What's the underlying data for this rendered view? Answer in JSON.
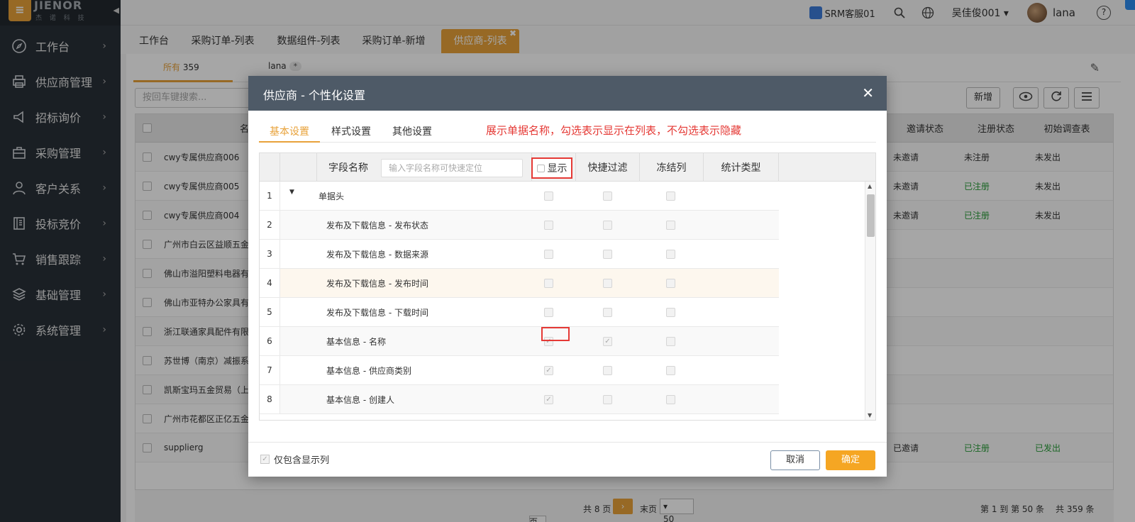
{
  "logo": {
    "text": "JIENOR",
    "sub": "杰 诺 科 技"
  },
  "sidebar": {
    "items": [
      {
        "label": "工作台",
        "icon": "compass-icon"
      },
      {
        "label": "供应商管理",
        "icon": "printer-icon"
      },
      {
        "label": "招标询价",
        "icon": "megaphone-icon"
      },
      {
        "label": "采购管理",
        "icon": "briefcase-icon"
      },
      {
        "label": "客户关系",
        "icon": "user-icon"
      },
      {
        "label": "投标竞价",
        "icon": "book-icon"
      },
      {
        "label": "销售跟踪",
        "icon": "cart-icon"
      },
      {
        "label": "基础管理",
        "icon": "layers-icon"
      },
      {
        "label": "系统管理",
        "icon": "gear-icon"
      }
    ]
  },
  "topbar": {
    "srm": "SRM客服01",
    "user_drop": "吴佳俊001",
    "username": "lana"
  },
  "page_tabs": [
    "工作台",
    "采购订单-列表",
    "数据组件-列表",
    "采购订单-新增",
    "供应商-列表"
  ],
  "sub_tabs": {
    "all_label": "所有",
    "all_count": "359",
    "lana_label": "lana",
    "lana_badge": "*"
  },
  "search": {
    "placeholder": "按回车键搜索..."
  },
  "toolbar": {
    "new_label": "新增"
  },
  "grid": {
    "headers": {
      "name": "名称",
      "invite": "邀请状态",
      "register": "注册状态",
      "survey": "初始调查表"
    },
    "rows": [
      {
        "name": "cwy专属供应商006",
        "invite": "未邀请",
        "register": "未注册",
        "survey": "未发出",
        "reg_green": false
      },
      {
        "name": "cwy专属供应商005",
        "invite": "未邀请",
        "register": "已注册",
        "survey": "未发出",
        "reg_green": true
      },
      {
        "name": "cwy专属供应商004",
        "invite": "未邀请",
        "register": "已注册",
        "survey": "未发出",
        "reg_green": true
      },
      {
        "name": "广州市白云区益顺五金",
        "invite": "",
        "register": "",
        "survey": "",
        "reg_green": false
      },
      {
        "name": "佛山市溢阳塑料电器有",
        "invite": "",
        "register": "",
        "survey": "",
        "reg_green": false
      },
      {
        "name": "佛山市亚特办公家具有",
        "invite": "",
        "register": "",
        "survey": "",
        "reg_green": false
      },
      {
        "name": "浙江联通家具配件有限",
        "invite": "",
        "register": "",
        "survey": "",
        "reg_green": false
      },
      {
        "name": "苏世博（南京）减振系",
        "invite": "",
        "register": "",
        "survey": "",
        "reg_green": false
      },
      {
        "name": "凯斯宝玛五金贸易（上",
        "invite": "",
        "register": "",
        "survey": "",
        "reg_green": false
      },
      {
        "name": "广州市花都区正亿五金",
        "invite": "",
        "register": "",
        "survey": "",
        "reg_green": false
      },
      {
        "name": "supplierg",
        "invite": "已邀请",
        "register": "已注册",
        "survey": "已发出",
        "reg_green": true
      }
    ]
  },
  "pager": {
    "page_prefix": "第",
    "page_suffix": "页",
    "total_pages": "共 8 页",
    "last": "末页",
    "page_size": "50",
    "range": "第 1 到 第 50 条",
    "total": "共 359 条"
  },
  "modal": {
    "title": "供应商 - 个性化设置",
    "tabs": [
      "基本设置",
      "样式设置",
      "其他设置"
    ],
    "hint": "展示单据名称，勾选表示显示在列表，不勾选表示隐藏",
    "headers": {
      "field_name": "字段名称",
      "search_placeholder": "输入字段名称可快速定位",
      "show": "显示",
      "quick_filter": "快捷过滤",
      "freeze": "冻结列",
      "stat_type": "统计类型"
    },
    "rows": [
      {
        "num": "1",
        "name": "单据头",
        "show": false,
        "filter": false,
        "freeze": false
      },
      {
        "num": "2",
        "name": "发布及下载信息 - 发布状态",
        "show": false,
        "filter": false,
        "freeze": false
      },
      {
        "num": "3",
        "name": "发布及下载信息 - 数据来源",
        "show": false,
        "filter": false,
        "freeze": false
      },
      {
        "num": "4",
        "name": "发布及下载信息 - 发布时间",
        "show": false,
        "filter": false,
        "freeze": false
      },
      {
        "num": "5",
        "name": "发布及下载信息 - 下载时间",
        "show": false,
        "filter": false,
        "freeze": false
      },
      {
        "num": "6",
        "name": "基本信息 - 名称",
        "show": true,
        "filter": true,
        "freeze": false
      },
      {
        "num": "7",
        "name": "基本信息 - 供应商类别",
        "show": true,
        "filter": false,
        "freeze": false
      },
      {
        "num": "8",
        "name": "基本信息 - 创建人",
        "show": true,
        "filter": false,
        "freeze": false
      }
    ],
    "footer": {
      "only_show": "仅包含显示列",
      "cancel": "取消",
      "ok": "确定"
    }
  },
  "colors": {
    "accent": "#e8a23a",
    "sidebar": "#293038",
    "modal_header": "#4e5a67",
    "highlight": "#e53935",
    "ok_button": "#f5a623"
  }
}
